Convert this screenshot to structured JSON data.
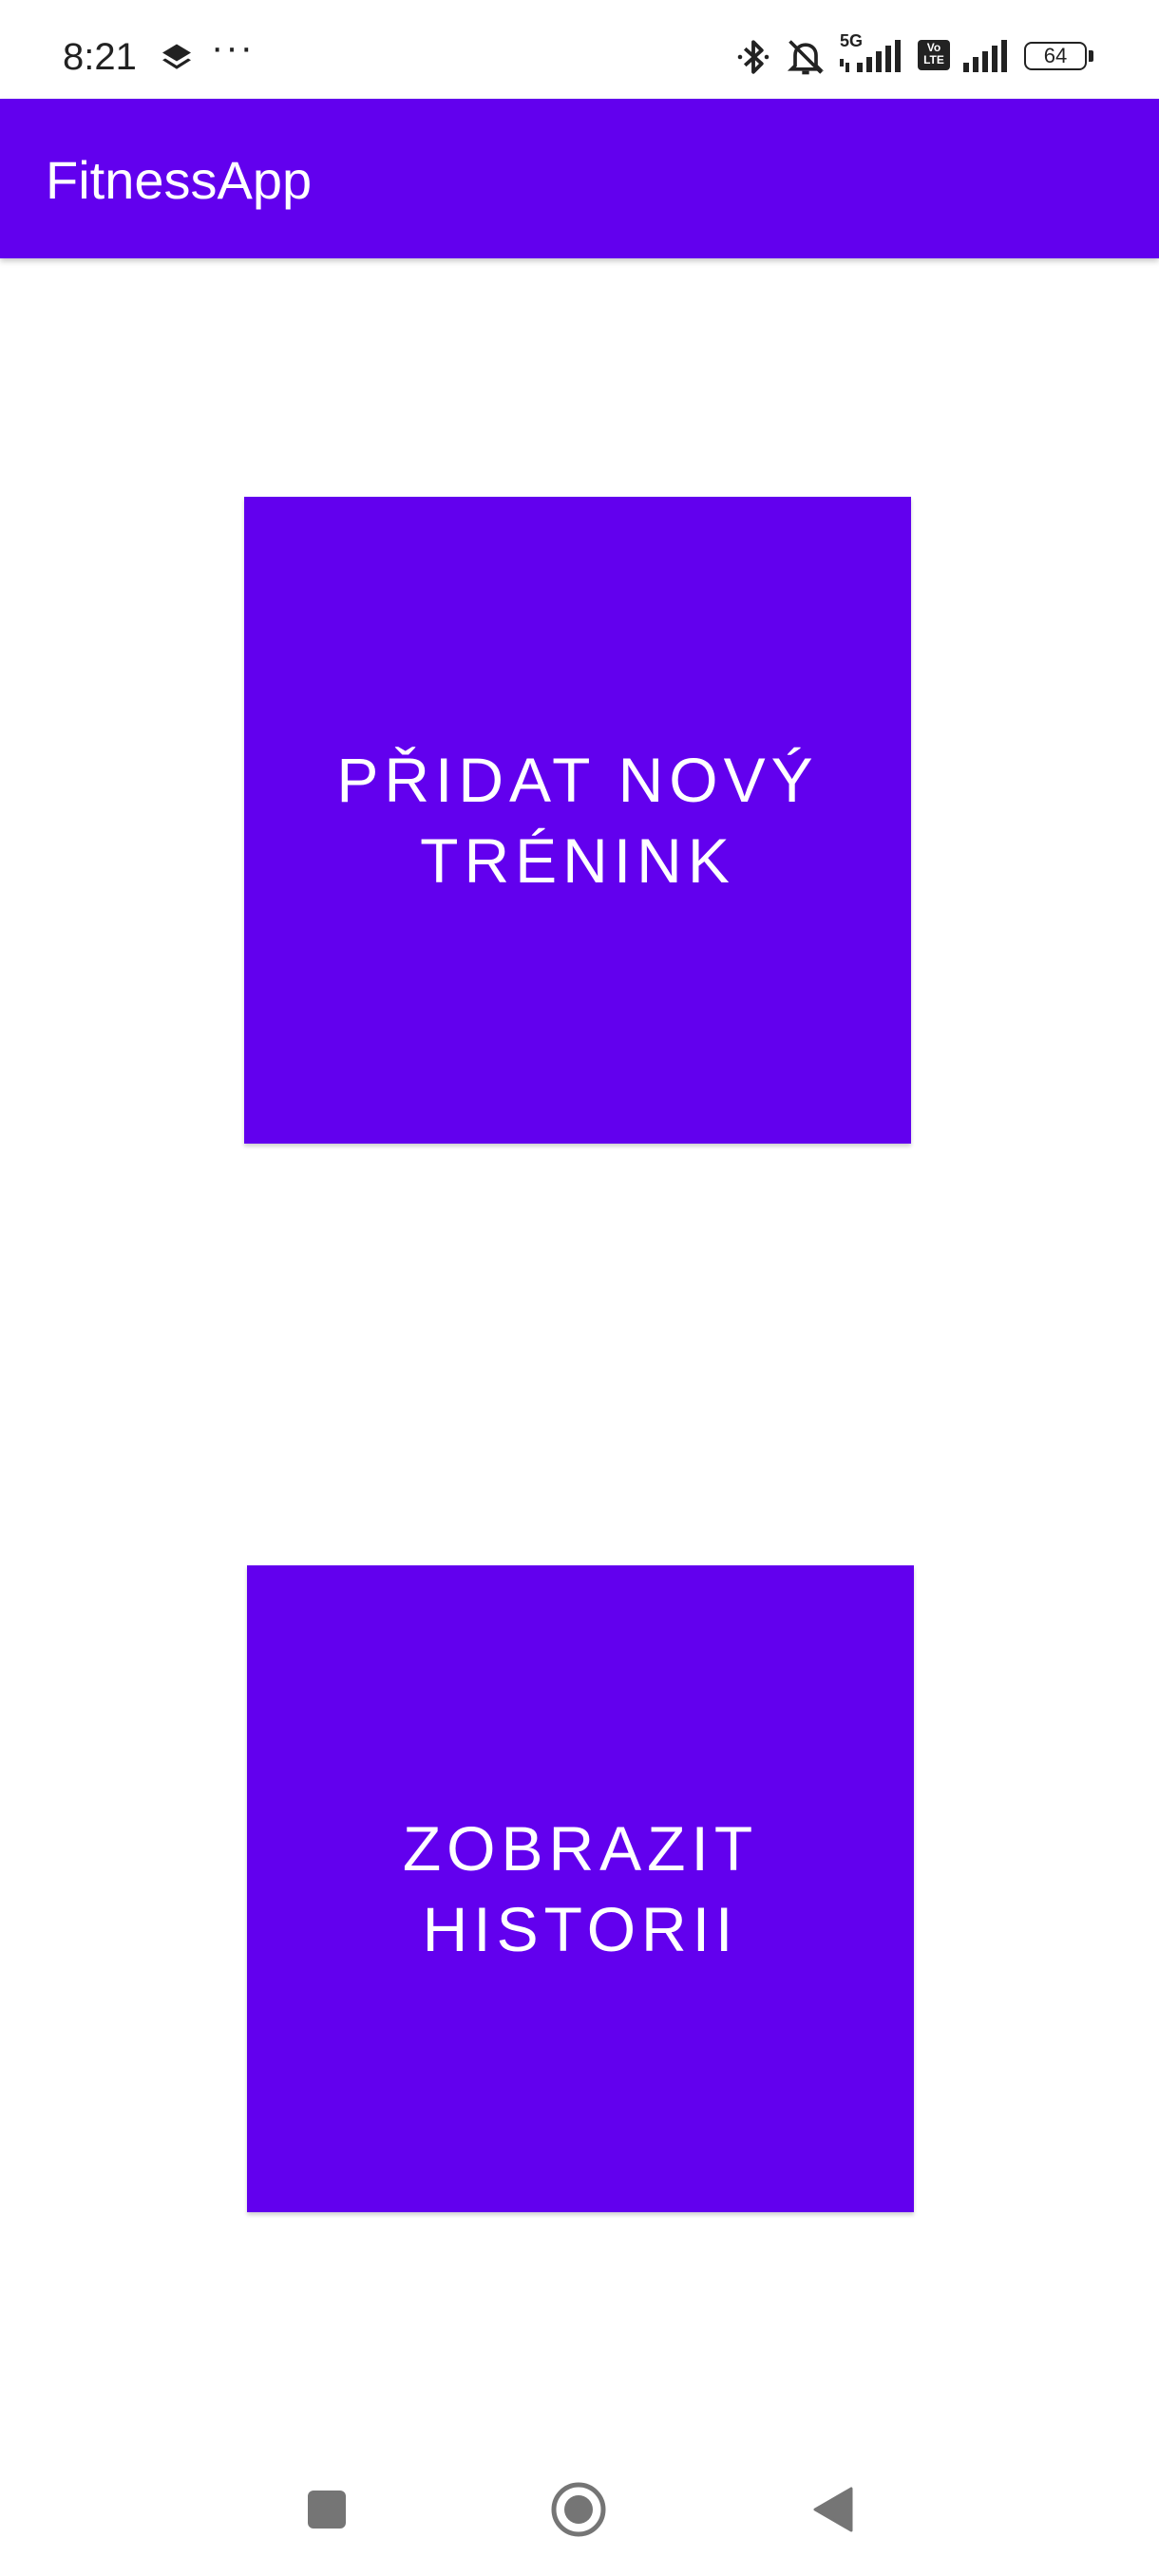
{
  "status_bar": {
    "time": "8:21",
    "more": "···",
    "network_label": "5G",
    "volte_label": "Vo LTE",
    "battery": "64",
    "icons": [
      "layers-icon",
      "bluetooth-icon",
      "bell-off-icon",
      "signal-icon",
      "volte-icon",
      "signal-icon",
      "battery-icon"
    ]
  },
  "app_bar": {
    "title": "FitnessApp"
  },
  "main": {
    "add_training_label": "Přidat nový trénink",
    "show_history_label": "Zobrazit historii"
  },
  "nav_bar": {
    "icons": [
      "recents-icon",
      "home-icon",
      "back-icon"
    ]
  },
  "colors": {
    "primary": "#6200ee",
    "on_primary": "#ffffff",
    "status_text": "#222222",
    "nav_icon": "#757575"
  }
}
